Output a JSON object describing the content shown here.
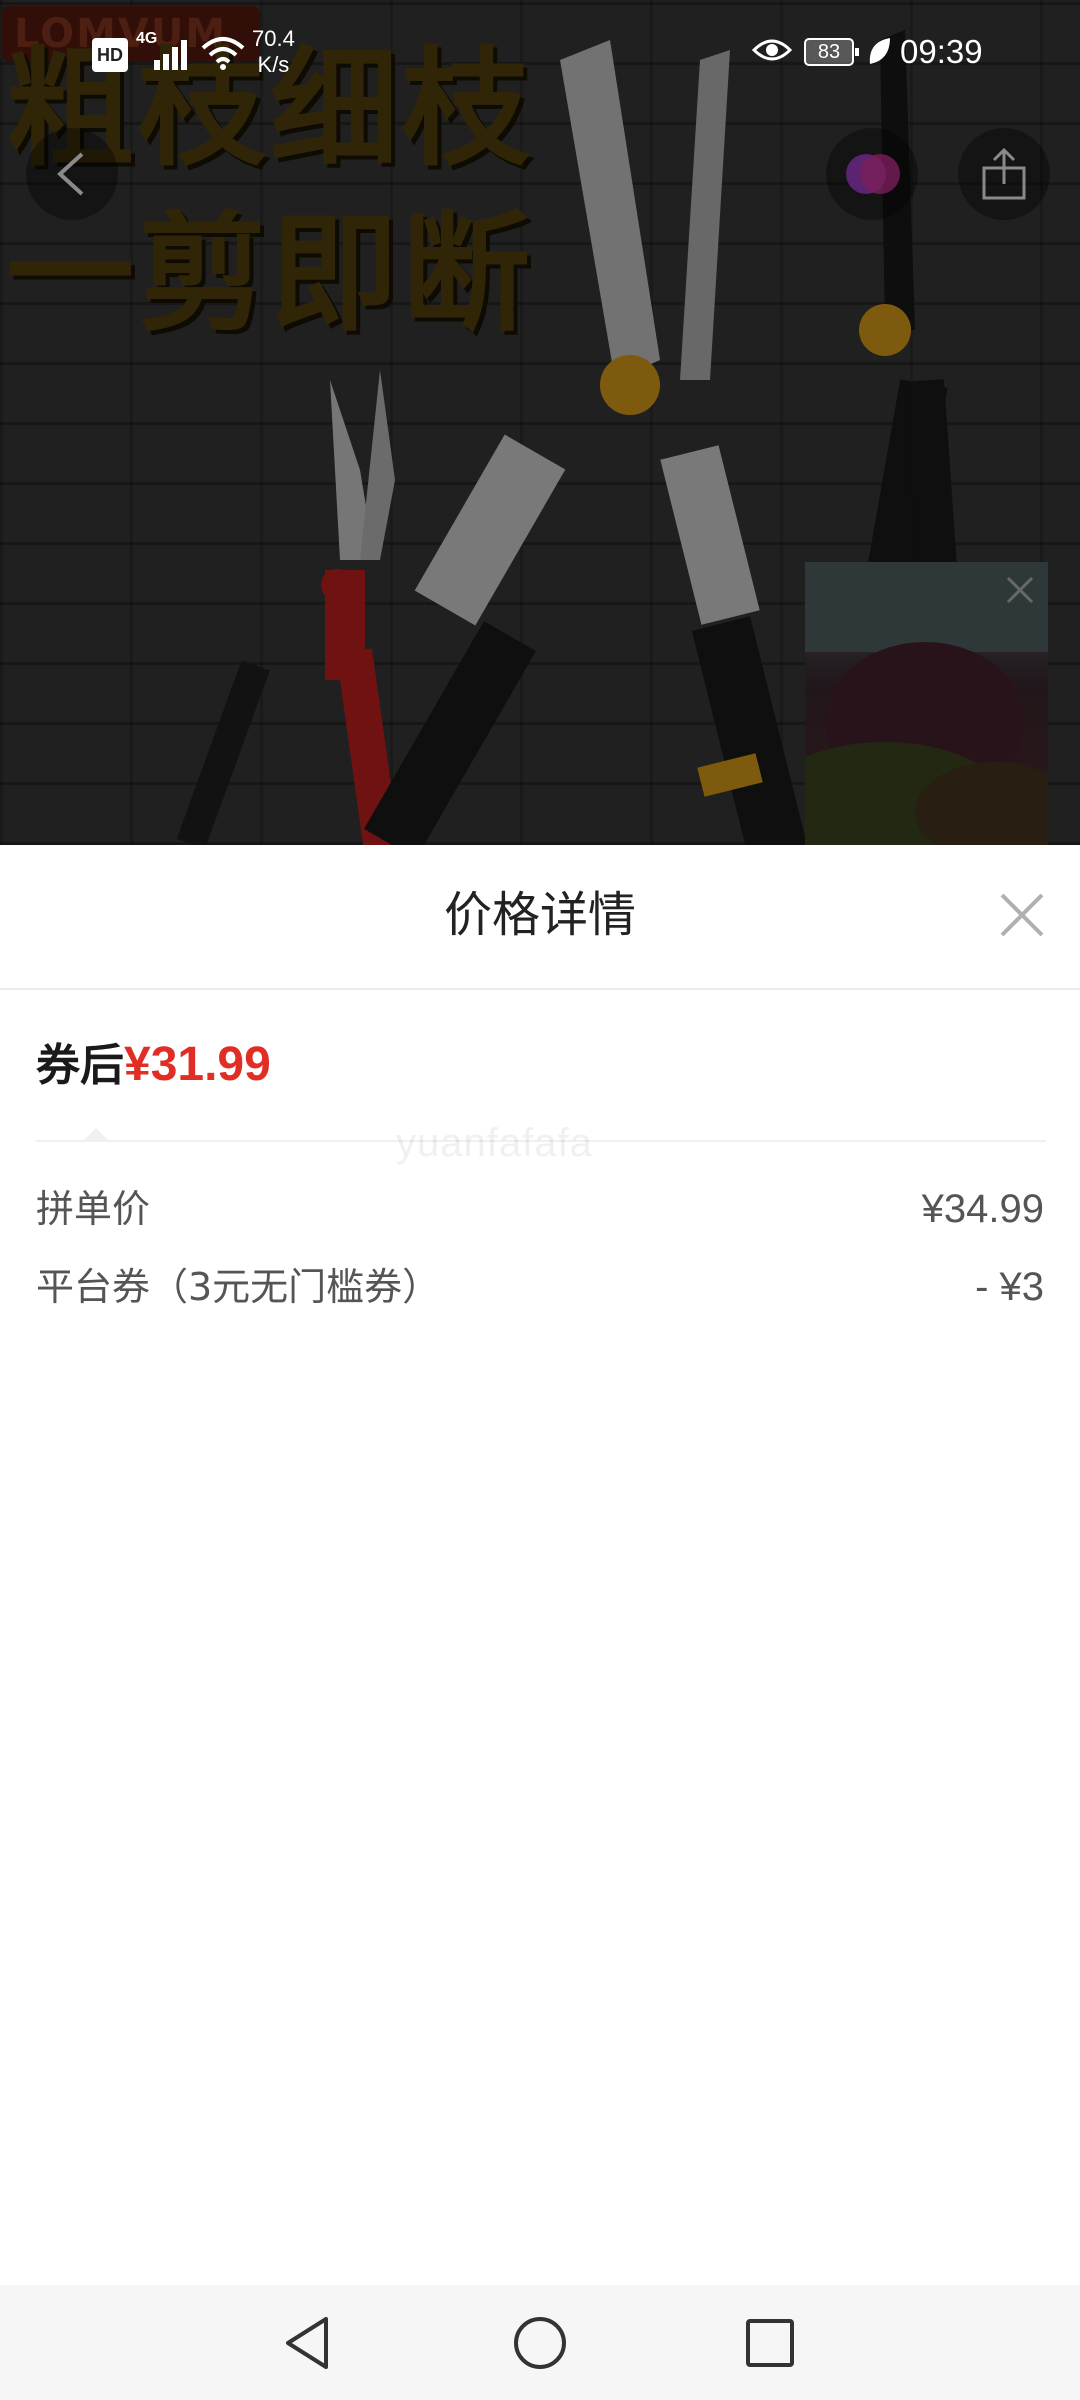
{
  "status_bar": {
    "hd": "HD",
    "network": "4G",
    "speed_value": "70.4",
    "speed_unit": "K/s",
    "battery": "83",
    "time": "09:39"
  },
  "hero": {
    "brand_logo": "LOMVUM",
    "promo_line_1": "粗枝细枝",
    "promo_line_2": "一剪即断"
  },
  "sheet": {
    "title": "价格详情",
    "final_price_label": "券后",
    "final_price_value": "¥31.99",
    "watermark": "yuanfafafa",
    "rows": [
      {
        "label": "拼单价",
        "value": "¥34.99"
      },
      {
        "label": "平台券（3元无门槛券）",
        "value": "- ¥3"
      }
    ]
  },
  "colors": {
    "price_red": "#e02e24",
    "overlay": "rgba(0,0,0,0.45)"
  },
  "icons": [
    "back-icon",
    "live-icon",
    "share-icon",
    "close-icon",
    "nav-back-icon",
    "nav-home-icon",
    "nav-recents-icon"
  ]
}
